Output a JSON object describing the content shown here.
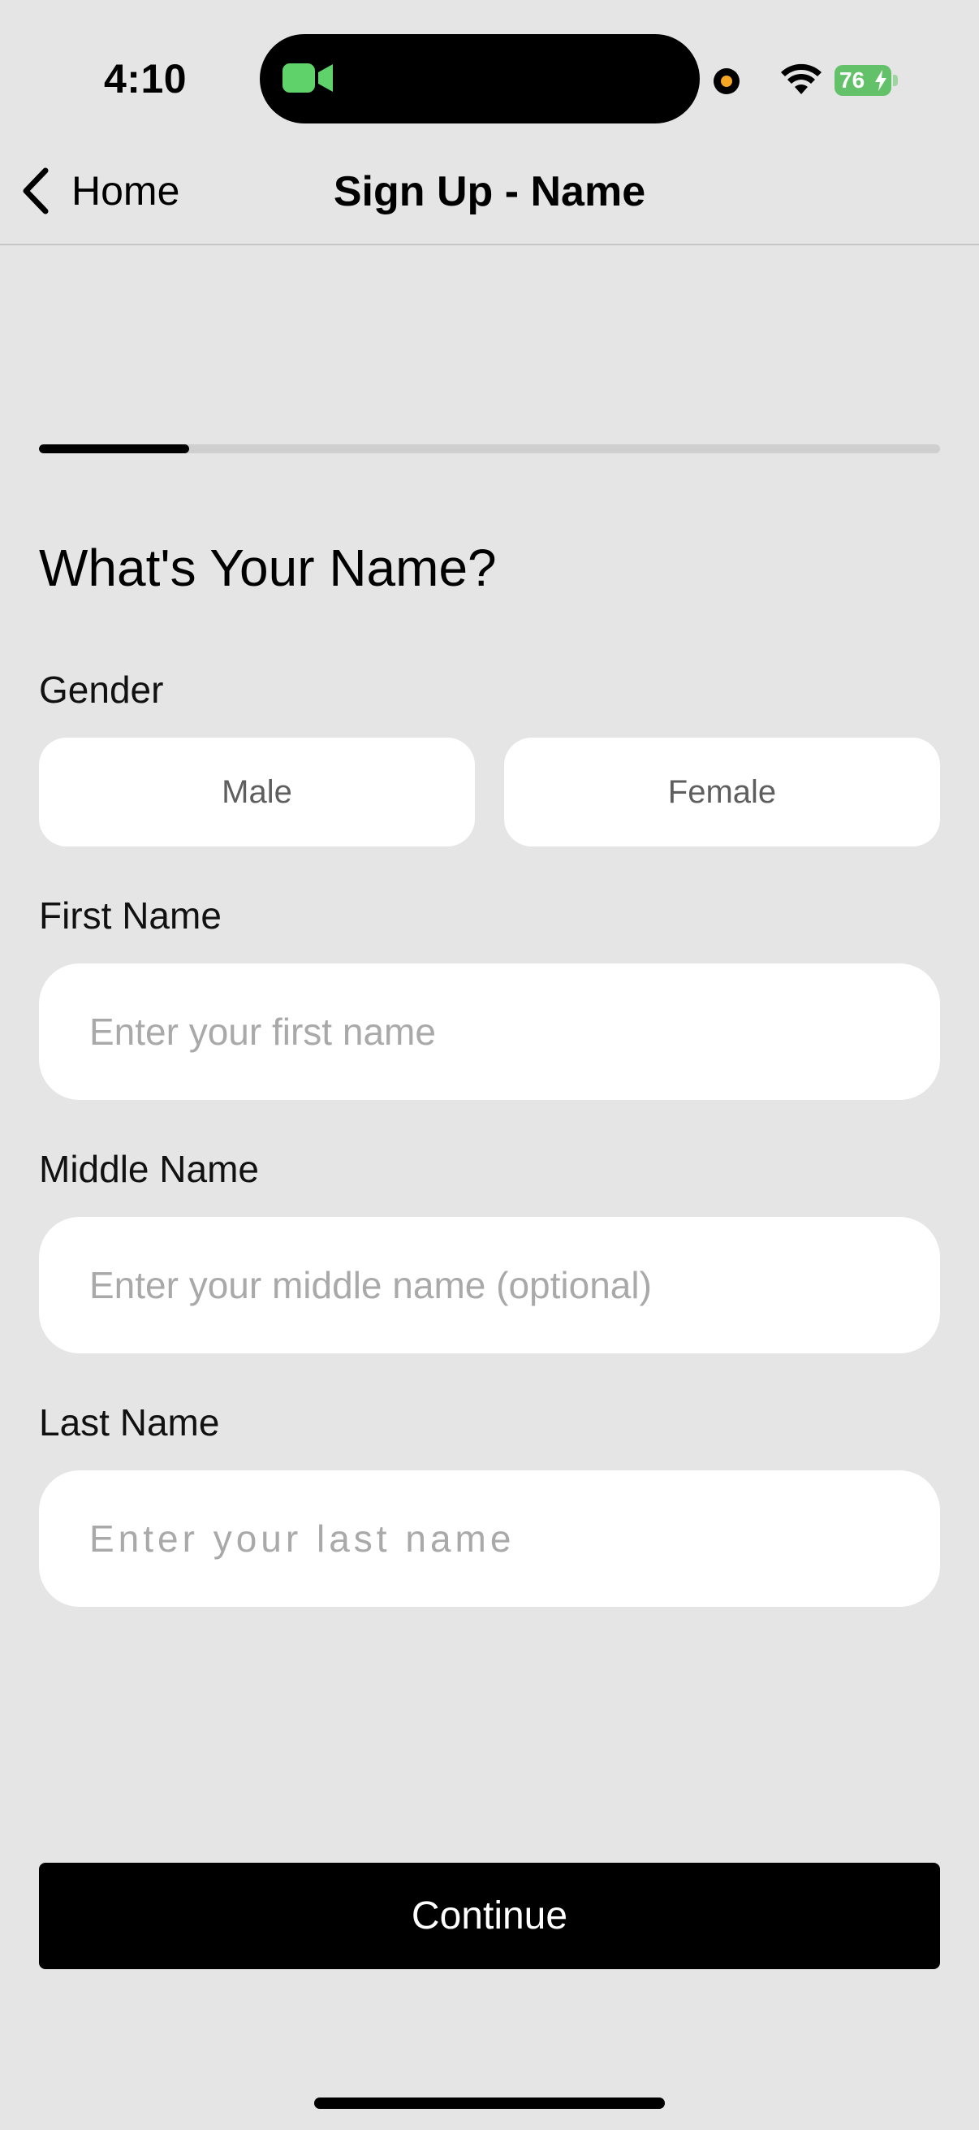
{
  "status_bar": {
    "time": "4:10",
    "battery_level": "76",
    "indicator_color": "#f5a623",
    "camera_indicator_color": "#5fd36a",
    "battery_color": "#63c16a"
  },
  "nav": {
    "back_label": "Home",
    "title": "Sign Up - Name"
  },
  "progress": {
    "fraction": 0.167
  },
  "form": {
    "heading": "What's Your Name?",
    "gender_label": "Gender",
    "gender_options": [
      "Male",
      "Female"
    ],
    "first_name": {
      "label": "First Name",
      "value": "",
      "placeholder": "Enter your first name"
    },
    "middle_name": {
      "label": "Middle Name",
      "value": "",
      "placeholder": "Enter your middle name (optional)"
    },
    "last_name": {
      "label": "Last Name",
      "value": "",
      "placeholder": "Enter your last name"
    },
    "continue_label": "Continue"
  },
  "icons": {
    "back": "chevron-left-icon",
    "camera": "video-camera-icon",
    "wifi": "wifi-icon",
    "battery": "battery-icon",
    "charging": "bolt-icon"
  }
}
